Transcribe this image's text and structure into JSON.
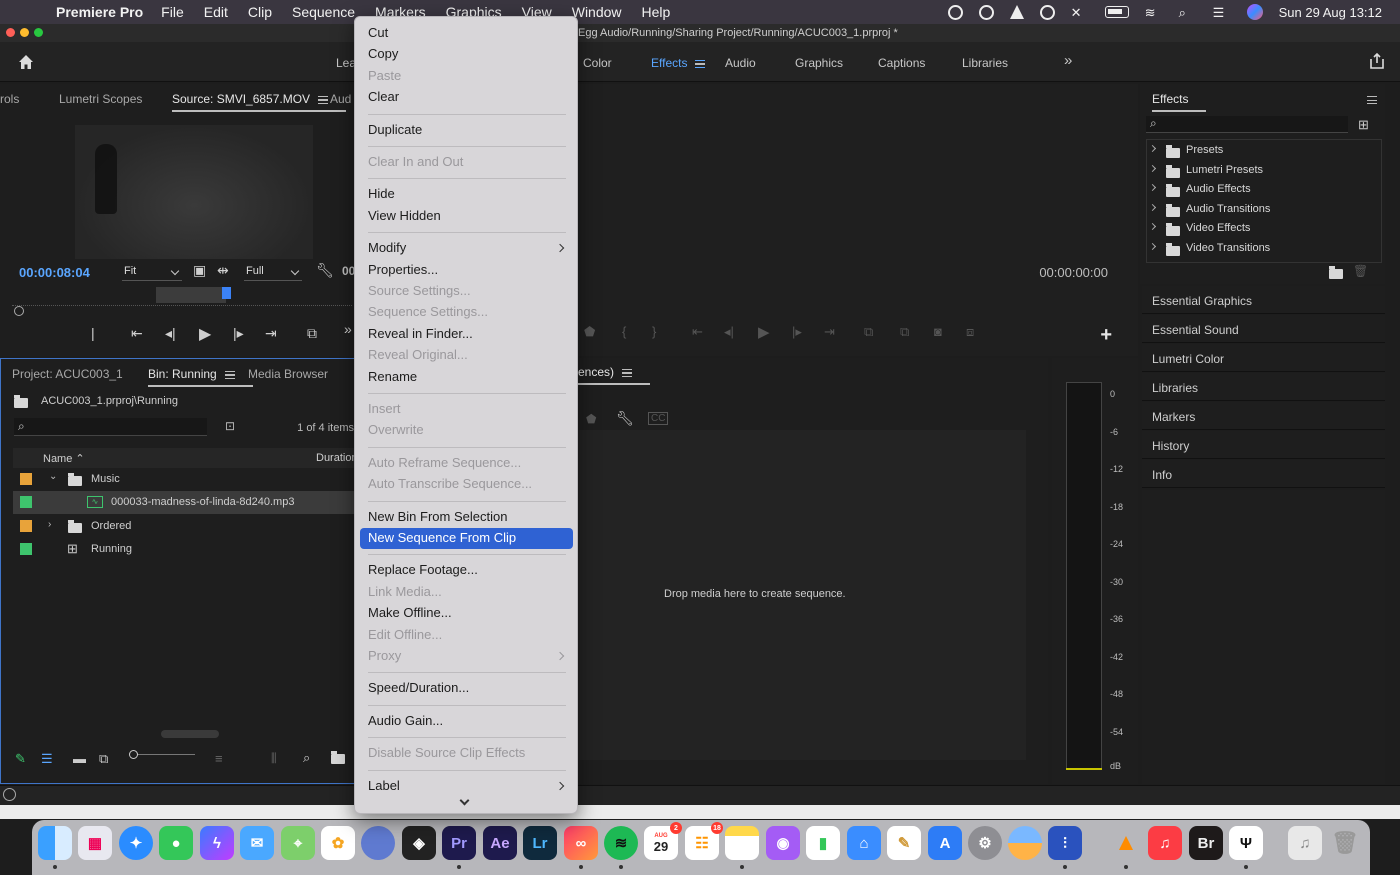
{
  "menubar": {
    "app_name": "Premiere Pro",
    "menus": [
      "File",
      "Edit",
      "Clip",
      "Sequence",
      "Markers",
      "Graphics",
      "View",
      "Window",
      "Help"
    ],
    "datetime": "Sun 29 Aug  13:12"
  },
  "window": {
    "title": "Egg Audio/Running/Sharing Project/Running/ACUC003_1.prproj *"
  },
  "workspaces": {
    "tabs": [
      {
        "label": "Lea"
      },
      {
        "label": "Color"
      },
      {
        "label": "Effects"
      },
      {
        "label": "Audio"
      },
      {
        "label": "Graphics"
      },
      {
        "label": "Captions"
      },
      {
        "label": "Libraries"
      }
    ],
    "more": "»"
  },
  "source": {
    "tabs": [
      "rols",
      "Lumetri Scopes",
      "Source: SMVI_6857.MOV",
      "Aud"
    ],
    "timecode": "00:00:08:04",
    "zoom": "Fit",
    "resolution": "Full",
    "tc_cut": "00"
  },
  "project": {
    "tabs": [
      "Project: ACUC003_1",
      "Bin: Running",
      "Media Browser"
    ],
    "path": "ACUC003_1.prproj\\Running",
    "count": "1 of 4 items",
    "col_name": "Name",
    "col_duration": "Duration",
    "rows": [
      {
        "label": "Music",
        "color": "#e8a33a",
        "type": "folder-open"
      },
      {
        "label": "000033-madness-of-linda-8d240.mp3",
        "color": "#3ec46d",
        "type": "audio"
      },
      {
        "label": "Ordered",
        "color": "#e8a33a",
        "type": "folder"
      },
      {
        "label": "Running",
        "color": "#3ec46d",
        "type": "sequence"
      }
    ]
  },
  "program": {
    "timecode": "00:00:00:00"
  },
  "timeline": {
    "tab": "ences)",
    "drop_text": "Drop media here to create sequence."
  },
  "meter": {
    "ticks": [
      "0",
      "-6",
      "-12",
      "-18",
      "-24",
      "-30",
      "-36",
      "-42",
      "-48",
      "-54",
      "dB"
    ]
  },
  "effects": {
    "title": "Effects",
    "items": [
      "Presets",
      "Lumetri Presets",
      "Audio Effects",
      "Audio Transitions",
      "Video Effects",
      "Video Transitions"
    ]
  },
  "side_panels": [
    "Essential Graphics",
    "Essential Sound",
    "Lumetri Color",
    "Libraries",
    "Markers",
    "History",
    "Info"
  ],
  "context_menu": {
    "items": [
      {
        "label": "Cut",
        "enabled": true
      },
      {
        "label": "Copy",
        "enabled": true
      },
      {
        "label": "Paste",
        "enabled": false
      },
      {
        "label": "Clear",
        "enabled": true
      },
      {
        "sep": true
      },
      {
        "label": "Duplicate",
        "enabled": true
      },
      {
        "sep": true
      },
      {
        "label": "Clear In and Out",
        "enabled": false
      },
      {
        "sep": true
      },
      {
        "label": "Hide",
        "enabled": true
      },
      {
        "label": "View Hidden",
        "enabled": true
      },
      {
        "sep": true
      },
      {
        "label": "Modify",
        "enabled": true,
        "submenu": true
      },
      {
        "label": "Properties...",
        "enabled": true
      },
      {
        "label": "Source Settings...",
        "enabled": false
      },
      {
        "label": "Sequence Settings...",
        "enabled": false
      },
      {
        "label": "Reveal in Finder...",
        "enabled": true
      },
      {
        "label": "Reveal Original...",
        "enabled": false
      },
      {
        "label": "Rename",
        "enabled": true
      },
      {
        "sep": true
      },
      {
        "label": "Insert",
        "enabled": false
      },
      {
        "label": "Overwrite",
        "enabled": false
      },
      {
        "sep": true
      },
      {
        "label": "Auto Reframe Sequence...",
        "enabled": false
      },
      {
        "label": "Auto Transcribe Sequence...",
        "enabled": false
      },
      {
        "sep": true
      },
      {
        "label": "New Bin From Selection",
        "enabled": true
      },
      {
        "label": "New Sequence From Clip",
        "enabled": true,
        "highlighted": true
      },
      {
        "sep": true
      },
      {
        "label": "Replace Footage...",
        "enabled": true
      },
      {
        "label": "Link Media...",
        "enabled": false
      },
      {
        "label": "Make Offline...",
        "enabled": true
      },
      {
        "label": "Edit Offline...",
        "enabled": false
      },
      {
        "label": "Proxy",
        "enabled": false,
        "submenu": true
      },
      {
        "sep": true
      },
      {
        "label": "Speed/Duration...",
        "enabled": true
      },
      {
        "sep": true
      },
      {
        "label": "Audio Gain...",
        "enabled": true
      },
      {
        "sep": true
      },
      {
        "label": "Disable Source Clip Effects",
        "enabled": false
      },
      {
        "sep": true
      },
      {
        "label": "Label",
        "enabled": true,
        "submenu": true
      }
    ]
  },
  "dock": {
    "calendar_month": "AUG",
    "calendar_day": "29",
    "calendar_badge": "2",
    "reminders_badge": "18",
    "labels": [
      "Pr",
      "Ae",
      "Lr",
      "Br"
    ]
  },
  "colors": {
    "accent": "#5aa6ff",
    "menu_highlight": "#2f62d3",
    "panel_focus": "#3f74c8"
  }
}
